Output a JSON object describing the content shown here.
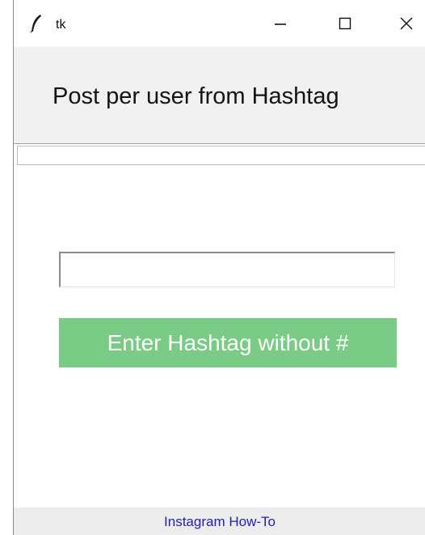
{
  "window": {
    "title": "tk",
    "icon": "feather-icon",
    "controls": {
      "minimize_icon": "minimize-icon",
      "maximize_icon": "maximize-icon",
      "close_icon": "close-icon"
    }
  },
  "header": {
    "title": "Post per user from Hashtag",
    "background": "#f0f0f0"
  },
  "form": {
    "hashtag_input": {
      "value": "",
      "placeholder": ""
    },
    "submit_button": {
      "label": "Enter Hashtag without #",
      "background": "#7acb86",
      "text_color": "#ffffff"
    }
  },
  "footer": {
    "link_text": "Instagram How-To",
    "link_color": "#2222b4",
    "background": "#ececec"
  }
}
